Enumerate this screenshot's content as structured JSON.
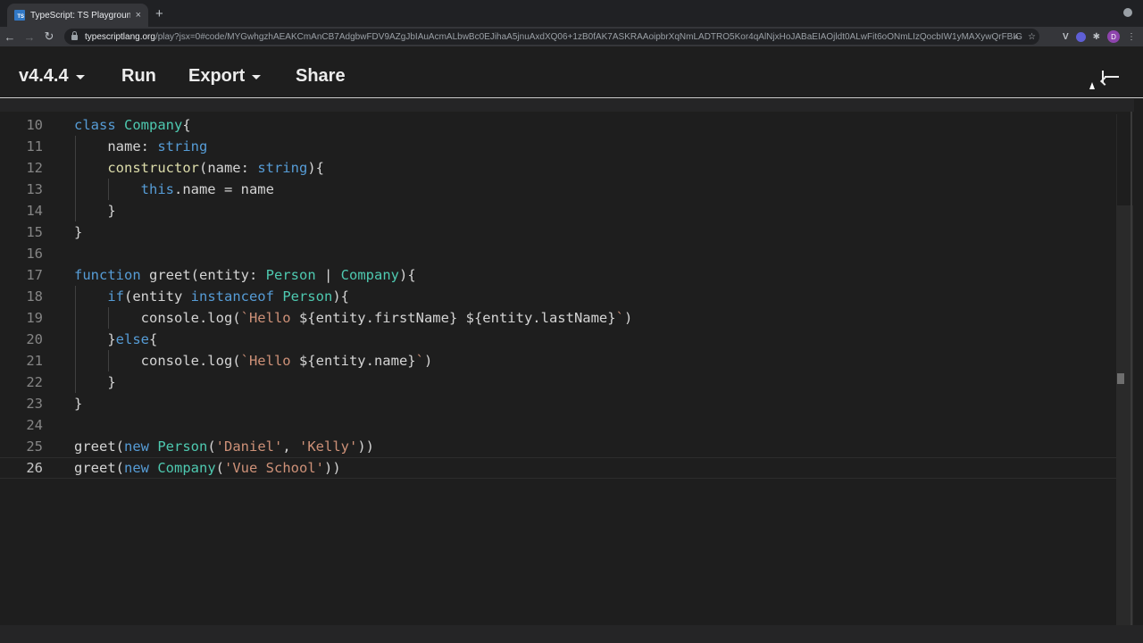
{
  "browser": {
    "tab_title": "TypeScript: TS Playground - An",
    "tab_favicon_text": "TS",
    "tab_close": "×",
    "new_tab": "+",
    "nav": {
      "back": "←",
      "forward": "→",
      "reload": "↻"
    },
    "url_host": "typescriptlang.org",
    "url_path": "/play?jsx=0#code/MYGwhgzhAEAKCmAnCB7AdgbwFDV9AZgJbIAuAcmALbwBc0EJihaA5jnuAxdXQ06+1zB0fAK7ASKRAAoipbrXqNmLADTRO5Kor4qAlNjxHoJABaEIAOjldt0ALwFit6oONmLIzQocbIW1yMAXywQrFBIG",
    "omnibox_icons": {
      "zoom": "⌕",
      "star": "☆"
    },
    "extensions": {
      "v": "V",
      "puzzle": "✱",
      "avatar": "D",
      "menu": "⋮"
    }
  },
  "header": {
    "version": "v4.4.4",
    "run": "Run",
    "export": "Export",
    "share": "Share"
  },
  "editor": {
    "lines": [
      {
        "num": "10",
        "tokens": [
          [
            "kw",
            "class "
          ],
          [
            "ty",
            "Company"
          ],
          [
            "txt",
            "{"
          ]
        ]
      },
      {
        "num": "11",
        "tokens": [
          [
            "txt",
            "    name: "
          ],
          [
            "kw",
            "string"
          ]
        ]
      },
      {
        "num": "12",
        "tokens": [
          [
            "txt",
            "    "
          ],
          [
            "fn",
            "constructor"
          ],
          [
            "txt",
            "(name: "
          ],
          [
            "kw",
            "string"
          ],
          [
            "txt",
            "){"
          ]
        ]
      },
      {
        "num": "13",
        "tokens": [
          [
            "txt",
            "        "
          ],
          [
            "kw",
            "this"
          ],
          [
            "txt",
            ".name = name"
          ]
        ]
      },
      {
        "num": "14",
        "tokens": [
          [
            "txt",
            "    }"
          ]
        ]
      },
      {
        "num": "15",
        "tokens": [
          [
            "txt",
            "}"
          ]
        ]
      },
      {
        "num": "16",
        "tokens": []
      },
      {
        "num": "17",
        "tokens": [
          [
            "kw",
            "function "
          ],
          [
            "txt",
            "greet(entity: "
          ],
          [
            "ty",
            "Person"
          ],
          [
            "txt",
            " | "
          ],
          [
            "ty",
            "Company"
          ],
          [
            "txt",
            "){"
          ]
        ]
      },
      {
        "num": "18",
        "tokens": [
          [
            "txt",
            "    "
          ],
          [
            "kw",
            "if"
          ],
          [
            "txt",
            "(entity "
          ],
          [
            "kw",
            "instanceof "
          ],
          [
            "ty",
            "Person"
          ],
          [
            "txt",
            "){"
          ]
        ]
      },
      {
        "num": "19",
        "tokens": [
          [
            "txt",
            "        console.log("
          ],
          [
            "str",
            "`Hello "
          ],
          [
            "txt",
            "${entity.firstName}"
          ],
          [
            "str",
            " "
          ],
          [
            "txt",
            "${entity.lastName}"
          ],
          [
            "str",
            "`"
          ],
          [
            "txt",
            ")"
          ]
        ]
      },
      {
        "num": "20",
        "tokens": [
          [
            "txt",
            "    }"
          ],
          [
            "kw",
            "else"
          ],
          [
            "txt",
            "{"
          ]
        ]
      },
      {
        "num": "21",
        "tokens": [
          [
            "txt",
            "        console.log("
          ],
          [
            "str",
            "`Hello "
          ],
          [
            "txt",
            "${entity.name}"
          ],
          [
            "str",
            "`"
          ],
          [
            "txt",
            ")"
          ]
        ]
      },
      {
        "num": "22",
        "tokens": [
          [
            "txt",
            "    }"
          ]
        ]
      },
      {
        "num": "23",
        "tokens": [
          [
            "txt",
            "}"
          ]
        ]
      },
      {
        "num": "24",
        "tokens": []
      },
      {
        "num": "25",
        "tokens": [
          [
            "txt",
            "greet("
          ],
          [
            "kw",
            "new "
          ],
          [
            "ty",
            "Person"
          ],
          [
            "txt",
            "("
          ],
          [
            "str",
            "'Daniel'"
          ],
          [
            "txt",
            ", "
          ],
          [
            "str",
            "'Kelly'"
          ],
          [
            "txt",
            "))"
          ]
        ]
      },
      {
        "num": "26",
        "tokens": [
          [
            "txt",
            "greet("
          ],
          [
            "kw",
            "new "
          ],
          [
            "ty",
            "Company"
          ],
          [
            "txt",
            "("
          ],
          [
            "str",
            "'Vue School'"
          ],
          [
            "txt",
            "))"
          ]
        ]
      }
    ],
    "active_line": "26"
  }
}
